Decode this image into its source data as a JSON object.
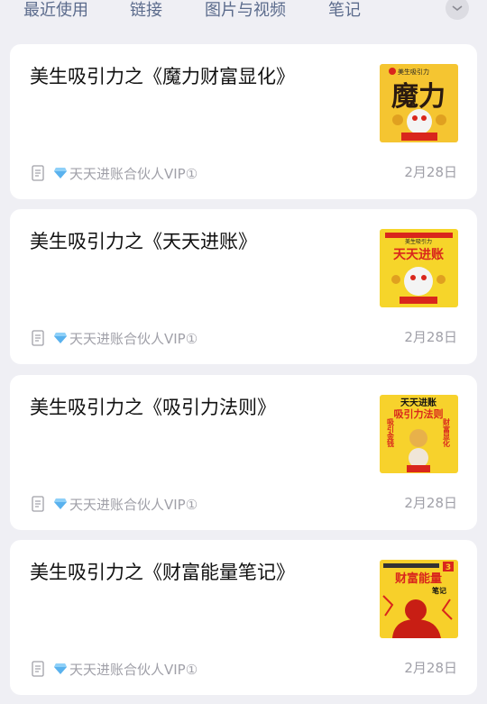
{
  "tabs": [
    "最近使用",
    "链接",
    "图片与视频",
    "笔记"
  ],
  "items": [
    {
      "title": "美生吸引力之《魔力财富显化》",
      "tag": "天天进账合伙人VIP①",
      "date": "2月28日",
      "thumb": {
        "top_text": "美生吸引力",
        "big_text": "魔力",
        "bg": "#f5c531",
        "accent": "#d9261c"
      }
    },
    {
      "title": "美生吸引力之《天天进账》",
      "tag": "天天进账合伙人VIP①",
      "date": "2月28日",
      "thumb": {
        "top_text": "美生吸引力",
        "big_text": "天天进账",
        "bg": "#f6d52a",
        "accent": "#d9261c"
      }
    },
    {
      "title": "美生吸引力之《吸引力法则》",
      "tag": "天天进账合伙人VIP①",
      "date": "2月28日",
      "thumb": {
        "top_text": "天天进账",
        "big_text": "吸引力法则",
        "side_left": "吸引金钱",
        "side_right": "财富显化",
        "bg": "#f7d22c",
        "accent": "#d9261c"
      }
    },
    {
      "title": "美生吸引力之《财富能量笔记》",
      "tag": "天天进账合伙人VIP①",
      "date": "2月28日",
      "thumb": {
        "big_text": "财富能量",
        "sub_text": "笔记",
        "badge": "3",
        "bg": "#f7d02a",
        "accent": "#d9261c"
      }
    }
  ]
}
